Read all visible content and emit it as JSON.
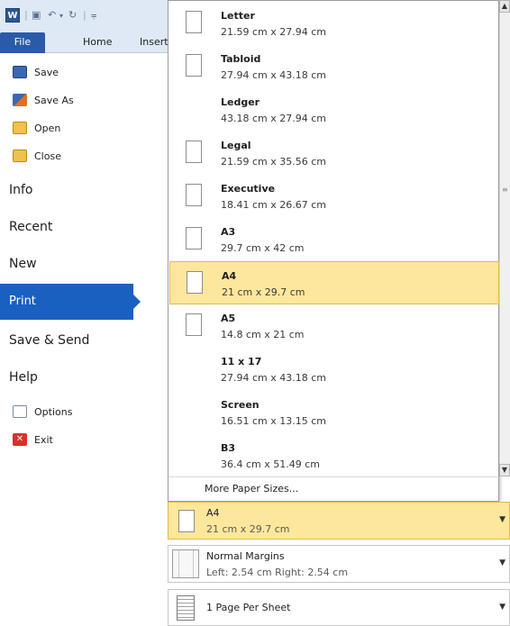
{
  "titlebar": {
    "app_icon": "W",
    "quick_access": [
      "save-icon",
      "undo-icon",
      "redo-icon",
      "customize-icon"
    ]
  },
  "ribbon": {
    "file_tab": "File",
    "tabs": [
      "Home",
      "Insert"
    ]
  },
  "nav": {
    "save": "Save",
    "save_as": "Save As",
    "open": "Open",
    "close": "Close",
    "info": "Info",
    "recent": "Recent",
    "new": "New",
    "print": "Print",
    "save_send": "Save & Send",
    "help": "Help",
    "options": "Options",
    "exit": "Exit"
  },
  "paper_sizes": [
    {
      "name": "Letter",
      "dims": "21.59 cm x 27.94 cm",
      "icon": "portrait"
    },
    {
      "name": "Tabloid",
      "dims": "27.94 cm x 43.18 cm",
      "icon": "portrait"
    },
    {
      "name": "Ledger",
      "dims": "43.18 cm x 27.94 cm",
      "icon": "none"
    },
    {
      "name": "Legal",
      "dims": "21.59 cm x 35.56 cm",
      "icon": "portrait"
    },
    {
      "name": "Executive",
      "dims": "18.41 cm x 26.67 cm",
      "icon": "portrait"
    },
    {
      "name": "A3",
      "dims": "29.7 cm x 42 cm",
      "icon": "portrait"
    },
    {
      "name": "A4",
      "dims": "21 cm x 29.7 cm",
      "icon": "portrait",
      "selected": true
    },
    {
      "name": "A5",
      "dims": "14.8 cm x 21 cm",
      "icon": "portrait"
    },
    {
      "name": "11 x 17",
      "dims": "27.94 cm x 43.18 cm",
      "icon": "none"
    },
    {
      "name": "Screen",
      "dims": "16.51 cm x 13.15 cm",
      "icon": "none"
    },
    {
      "name": "B3",
      "dims": "36.4 cm x 51.49 cm",
      "icon": "none"
    }
  ],
  "more_sizes": "More Paper Sizes...",
  "settings": {
    "paper": {
      "title": "A4",
      "sub": "21 cm x 29.7 cm"
    },
    "margins": {
      "title": "Normal Margins",
      "sub": "Left:  2.54 cm   Right:  2.54 cm"
    },
    "pages": {
      "title": "1 Page Per Sheet"
    }
  },
  "colors": {
    "accent": "#1a60c0",
    "highlight": "#fde79c",
    "highlight_border": "#e3b850"
  }
}
